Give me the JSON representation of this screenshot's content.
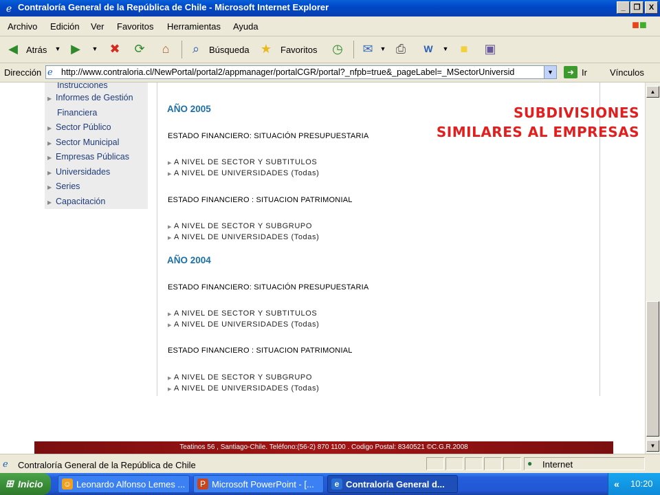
{
  "window": {
    "title": "Contraloría General de la República de Chile - Microsoft Internet Explorer",
    "buttons": {
      "minimize": "_",
      "maximize": "❐",
      "close": "X"
    }
  },
  "menu": [
    "Archivo",
    "Edición",
    "Ver",
    "Favoritos",
    "Herramientas",
    "Ayuda"
  ],
  "toolbar": {
    "back_label": "Atrás",
    "search_label": "Búsqueda",
    "favorites_label": "Favoritos"
  },
  "address": {
    "label": "Dirección",
    "url": "http://www.contraloria.cl/NewPortal/portal2/appmanager/portalCGR/portal?_nfpb=true&_pageLabel=_MSectorUniversid",
    "go_label": "Ir",
    "links_label": "Vínculos"
  },
  "sidebar": {
    "items": [
      "Instrucciones",
      "Informes de Gestión",
      "Financiera",
      "Sector Público",
      "Sector Municipal",
      "Empresas Públicas",
      "Universidades",
      "Series",
      "Capacitación"
    ]
  },
  "main": {
    "blocks": [
      {
        "year": "AÑO 2005",
        "sections": [
          {
            "title": "ESTADO FINANCIERO: SITUACIÓN PRESUPUESTARIA",
            "links": [
              "A NIVEL DE SECTOR Y SUBTITULOS",
              "A NIVEL DE UNIVERSIDADES (Todas)"
            ]
          },
          {
            "title": "ESTADO FINANCIERO : SITUACION PATRIMONIAL",
            "links": [
              "A NIVEL DE SECTOR Y SUBGRUPO",
              "A NIVEL DE UNIVERSIDADES (Todas)"
            ]
          }
        ]
      },
      {
        "year": "AÑO 2004",
        "sections": [
          {
            "title": "ESTADO FINANCIERO: SITUACIÓN PRESUPUESTARIA",
            "links": [
              "A NIVEL DE SECTOR Y SUBTITULOS",
              "A NIVEL DE UNIVERSIDADES (Todas)"
            ]
          },
          {
            "title": "ESTADO FINANCIERO : SITUACION PATRIMONIAL",
            "links": [
              "A NIVEL DE SECTOR Y SUBGRUPO",
              "A NIVEL DE UNIVERSIDADES (Todas)"
            ]
          }
        ]
      }
    ],
    "annotation_line1": "SUBDIVISIONES",
    "annotation_line2": "SIMILARES AL EMPRESAS",
    "footer": "Teatinos 56 , Santiago-Chile. Teléfono:(56-2) 870 1100 . Codigo Postal: 8340521 ©C.G.R.2008"
  },
  "status": {
    "text": "Contraloría General de la República de Chile",
    "zone": "Internet"
  },
  "taskbar": {
    "start_label": "Inicio",
    "tasks": [
      "Leonardo Alfonso Lemes ...",
      "Microsoft PowerPoint - [...",
      "Contraloría General d..."
    ],
    "clock": "10:20",
    "tray_chevron": "«"
  },
  "colors": {
    "accent_red": "#e21f1f",
    "year_blue": "#1b6fa8",
    "footer_red": "#a11414"
  }
}
